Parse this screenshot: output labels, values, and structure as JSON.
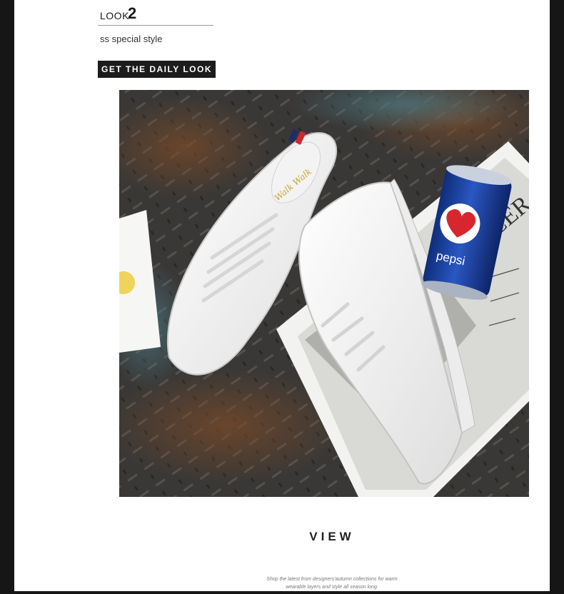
{
  "look": {
    "word": "LOOK",
    "number": "2"
  },
  "subtitle": "ss special style",
  "badge": {
    "label": "GET THE DAILY LOOK"
  },
  "photo": {
    "can_brand": "pepsi",
    "paper_text": "CER",
    "signature": "Walk Walk"
  },
  "view": {
    "heading": "VIEW"
  },
  "caption": {
    "line1": "Shop the latest from designers'autumn collections for warm",
    "line2": "wearable layers and style all season long."
  },
  "colors": {
    "page": "#ffffff",
    "frame": "#161616",
    "badge": "#1c1c1c",
    "can_blue": "#1b3f9e",
    "heart_red": "#d8262e"
  }
}
